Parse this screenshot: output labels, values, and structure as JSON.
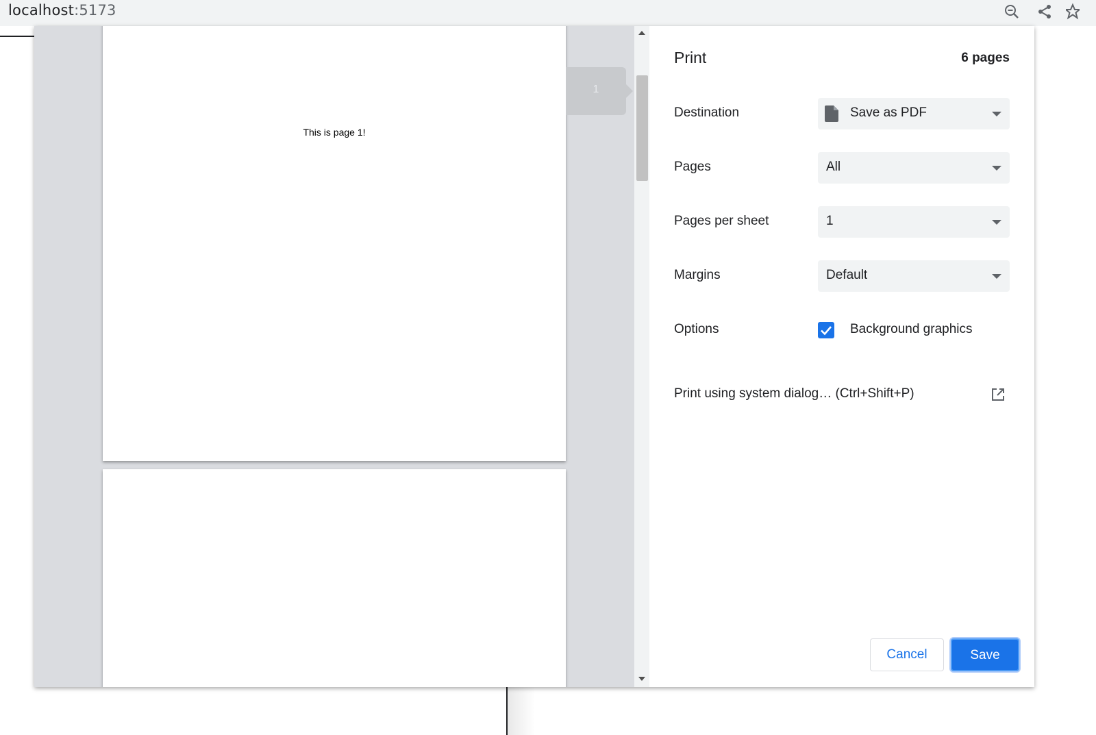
{
  "browser": {
    "host": "localhost",
    "port": ":5173",
    "icons": [
      "zoom-out-icon",
      "share-icon",
      "bookmark-star-icon"
    ]
  },
  "preview": {
    "page1_text": "This is page 1!",
    "page_number": "1"
  },
  "print": {
    "title": "Print",
    "page_count": "6 pages",
    "destination": {
      "label": "Destination",
      "value": "Save as PDF",
      "icon": "document-icon"
    },
    "pages": {
      "label": "Pages",
      "value": "All"
    },
    "pages_per_sheet": {
      "label": "Pages per sheet",
      "value": "1"
    },
    "margins": {
      "label": "Margins",
      "value": "Default"
    },
    "options": {
      "label": "Options",
      "background_graphics": "Background graphics",
      "background_graphics_checked": true
    },
    "system_dialog": "Print using system dialog… (Ctrl+Shift+P)",
    "cancel_label": "Cancel",
    "save_label": "Save"
  },
  "colors": {
    "accent": "#1a73e8",
    "preview_bg": "#dadce0",
    "field_bg": "#f1f3f4"
  }
}
